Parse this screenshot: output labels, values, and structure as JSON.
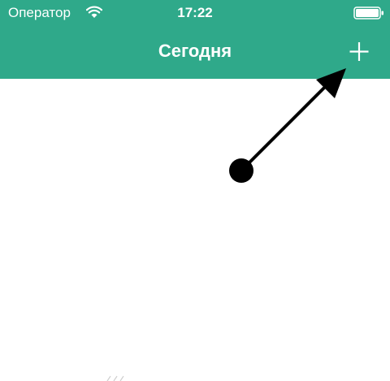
{
  "status_bar": {
    "carrier": "Оператор",
    "time": "17:22",
    "wifi_icon": "wifi-icon",
    "battery_icon": "battery-icon"
  },
  "nav_bar": {
    "title": "Сегодня",
    "add_icon": "plus-icon"
  },
  "annotation": {
    "icon": "pointer-arrow"
  },
  "colors": {
    "header_background": "#2fa98a",
    "header_text": "#ffffff",
    "content_background": "#ffffff",
    "arrow": "#000000"
  }
}
